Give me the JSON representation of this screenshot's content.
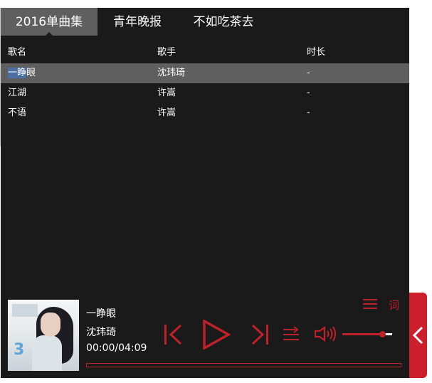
{
  "tabs": [
    {
      "label": "2016单曲集",
      "active": true
    },
    {
      "label": "青年晚报",
      "active": false
    },
    {
      "label": "不如吃茶去",
      "active": false
    }
  ],
  "table": {
    "headers": [
      "歌名",
      "歌手",
      "时长"
    ],
    "rows": [
      {
        "title_highlight": "一睁",
        "title_rest": "眼",
        "artist": "沈玮琦",
        "duration": "-",
        "selected": true
      },
      {
        "title": "江湖",
        "artist": "许嵩",
        "duration": "-",
        "selected": false
      },
      {
        "title": "不语",
        "artist": "许嵩",
        "duration": "-",
        "selected": false
      }
    ]
  },
  "player": {
    "album_cover_icon": "album-cover-image",
    "cover_text": "3",
    "song_title": "一睁眼",
    "artist": "沈玮琦",
    "time": "00:00/04:09",
    "progress": 0,
    "volume": 0.8,
    "playlist_icon": "list-icon",
    "lyrics_label": "词",
    "prev_icon": "skip-previous-icon",
    "play_icon": "play-icon",
    "next_icon": "skip-next-icon",
    "mode_icon": "play-order-icon",
    "volume_icon": "speaker-icon"
  },
  "side_tab_icon": "chevron-left-icon",
  "colors": {
    "background": "#1b1a1b",
    "tab_active": "#5f5f5f",
    "row_selected": "#5f5f5f",
    "accent": "#c0202a",
    "side_tab": "#cc1f2b",
    "text": "#ffffff"
  }
}
